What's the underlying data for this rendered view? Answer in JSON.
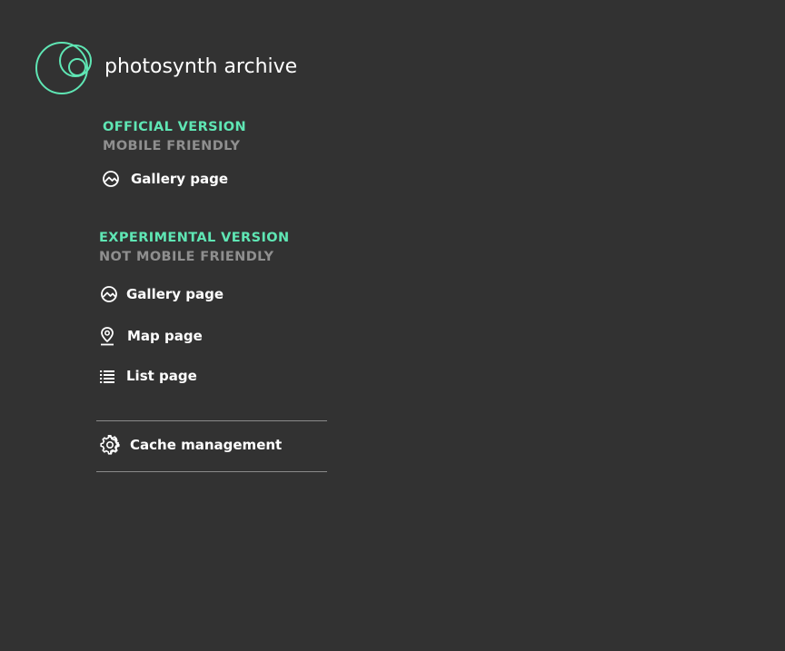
{
  "app": {
    "title": "photosynth archive",
    "logo_icon": "photosynth-rings-logo",
    "accent_color": "#5fe6b4"
  },
  "official": {
    "heading": "OFFICIAL VERSION",
    "subheading": "MOBILE FRIENDLY",
    "items": [
      {
        "label": "Gallery page",
        "icon": "gallery-icon"
      }
    ]
  },
  "experimental": {
    "heading": "EXPERIMENTAL VERSION",
    "subheading": "NOT MOBILE FRIENDLY",
    "items": [
      {
        "label": "Gallery page",
        "icon": "gallery-icon"
      },
      {
        "label": "Map page",
        "icon": "map-pin-icon"
      },
      {
        "label": "List page",
        "icon": "list-icon"
      }
    ]
  },
  "cache": {
    "label": "Cache management",
    "icon": "gear-icon"
  }
}
